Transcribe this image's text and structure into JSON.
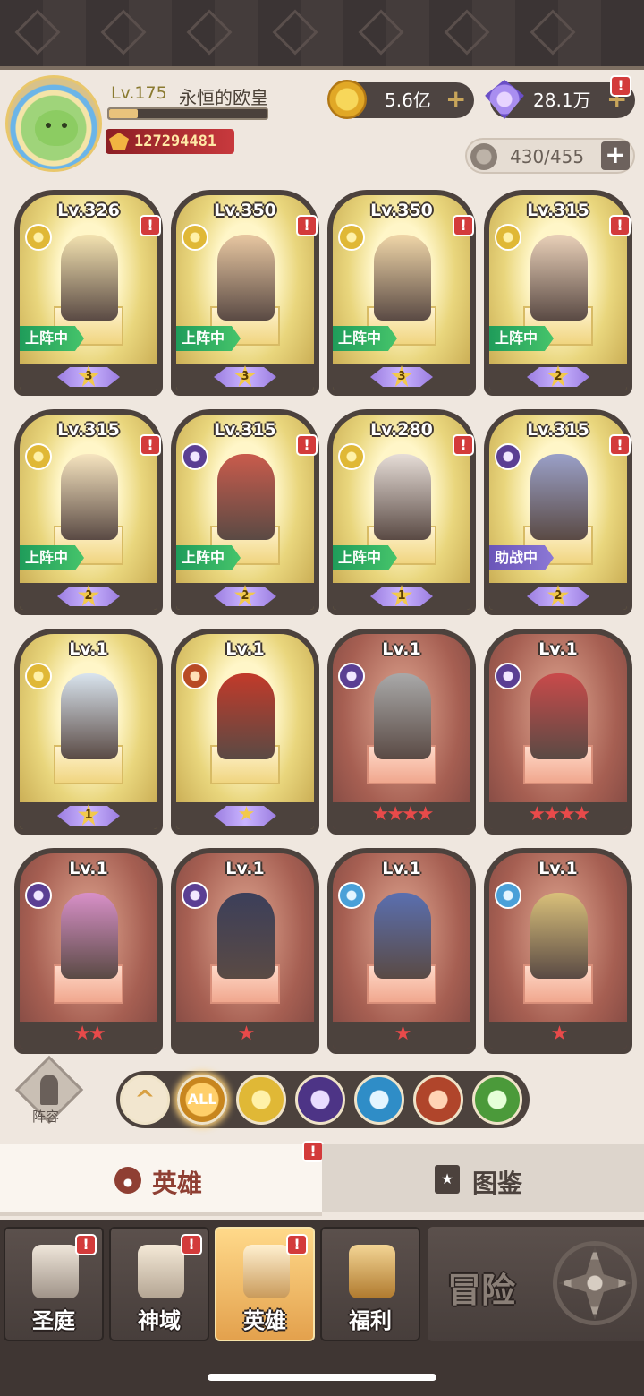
{
  "player": {
    "level": "Lv.175",
    "name": "永恒的欧皇",
    "power": "127294481",
    "exp_progress": 0.18
  },
  "currencies": {
    "gold": "5.6亿",
    "diamonds": "28.1万",
    "plus": "+"
  },
  "roster": {
    "capacity": "430/455",
    "plus": "+"
  },
  "alert": "!",
  "heroes": [
    {
      "level": "Lv.326",
      "element": "light",
      "status": "上阵中",
      "star": "3",
      "alert": true
    },
    {
      "level": "Lv.350",
      "element": "light",
      "status": "上阵中",
      "star": "3",
      "alert": true
    },
    {
      "level": "Lv.350",
      "element": "light",
      "status": "上阵中",
      "star": "3",
      "alert": true
    },
    {
      "level": "Lv.315",
      "element": "light",
      "status": "上阵中",
      "star": "2",
      "alert": true
    },
    {
      "level": "Lv.315",
      "element": "light",
      "status": "上阵中",
      "star": "2",
      "alert": true
    },
    {
      "level": "Lv.315",
      "element": "dark",
      "status": "上阵中",
      "star": "2",
      "alert": true
    },
    {
      "level": "Lv.280",
      "element": "light",
      "status": "上阵中",
      "star": "1",
      "alert": true
    },
    {
      "level": "Lv.315",
      "element": "dark",
      "status": "助战中",
      "star": "2",
      "alert": true
    },
    {
      "level": "Lv.1",
      "element": "light",
      "status": "",
      "star": "1"
    },
    {
      "level": "Lv.1",
      "element": "fire",
      "status": "",
      "stars": "★"
    },
    {
      "level": "Lv.1",
      "element": "dark",
      "status": "",
      "stars": "★★★★"
    },
    {
      "level": "Lv.1",
      "element": "dark",
      "status": "",
      "stars": "★★★★"
    },
    {
      "level": "Lv.1",
      "element": "dark",
      "status": "",
      "stars": "★★"
    },
    {
      "level": "Lv.1",
      "element": "dark",
      "status": "",
      "stars": "★"
    },
    {
      "level": "Lv.1",
      "element": "ice",
      "status": "",
      "stars": "★"
    },
    {
      "level": "Lv.1",
      "element": "ice",
      "status": "",
      "stars": "★"
    }
  ],
  "lineup": {
    "label": "阵容"
  },
  "filters": {
    "all_label": "ALL",
    "up_symbol": "^"
  },
  "tabs": {
    "heroes": "英雄",
    "codex": "图鉴",
    "codex_icon": "★"
  },
  "nav": {
    "court": "圣庭",
    "domain": "神域",
    "heroes": "英雄",
    "welfare": "福利",
    "adventure": "冒险"
  },
  "colors": {
    "accent_gold": "#e9c37c",
    "alert_red": "#d33b3b",
    "deployed_green": "#1f9c5a",
    "assist_purple": "#6a55b8"
  }
}
